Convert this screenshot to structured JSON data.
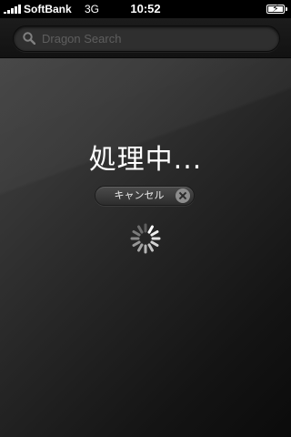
{
  "status_bar": {
    "carrier": "SoftBank",
    "network": "3G",
    "time": "10:52",
    "signal_bars": 5,
    "battery": "charging"
  },
  "search": {
    "placeholder": "Dragon Search",
    "value": ""
  },
  "overlay": {
    "title": "処理中...",
    "cancel_label": "キャンセル",
    "cancel_icon": "close-icon",
    "spinner_icon": "activity-spinner-icon"
  },
  "colors": {
    "background": "#2a2a2a",
    "text": "#ffffff",
    "button": "#3a3a3a"
  }
}
